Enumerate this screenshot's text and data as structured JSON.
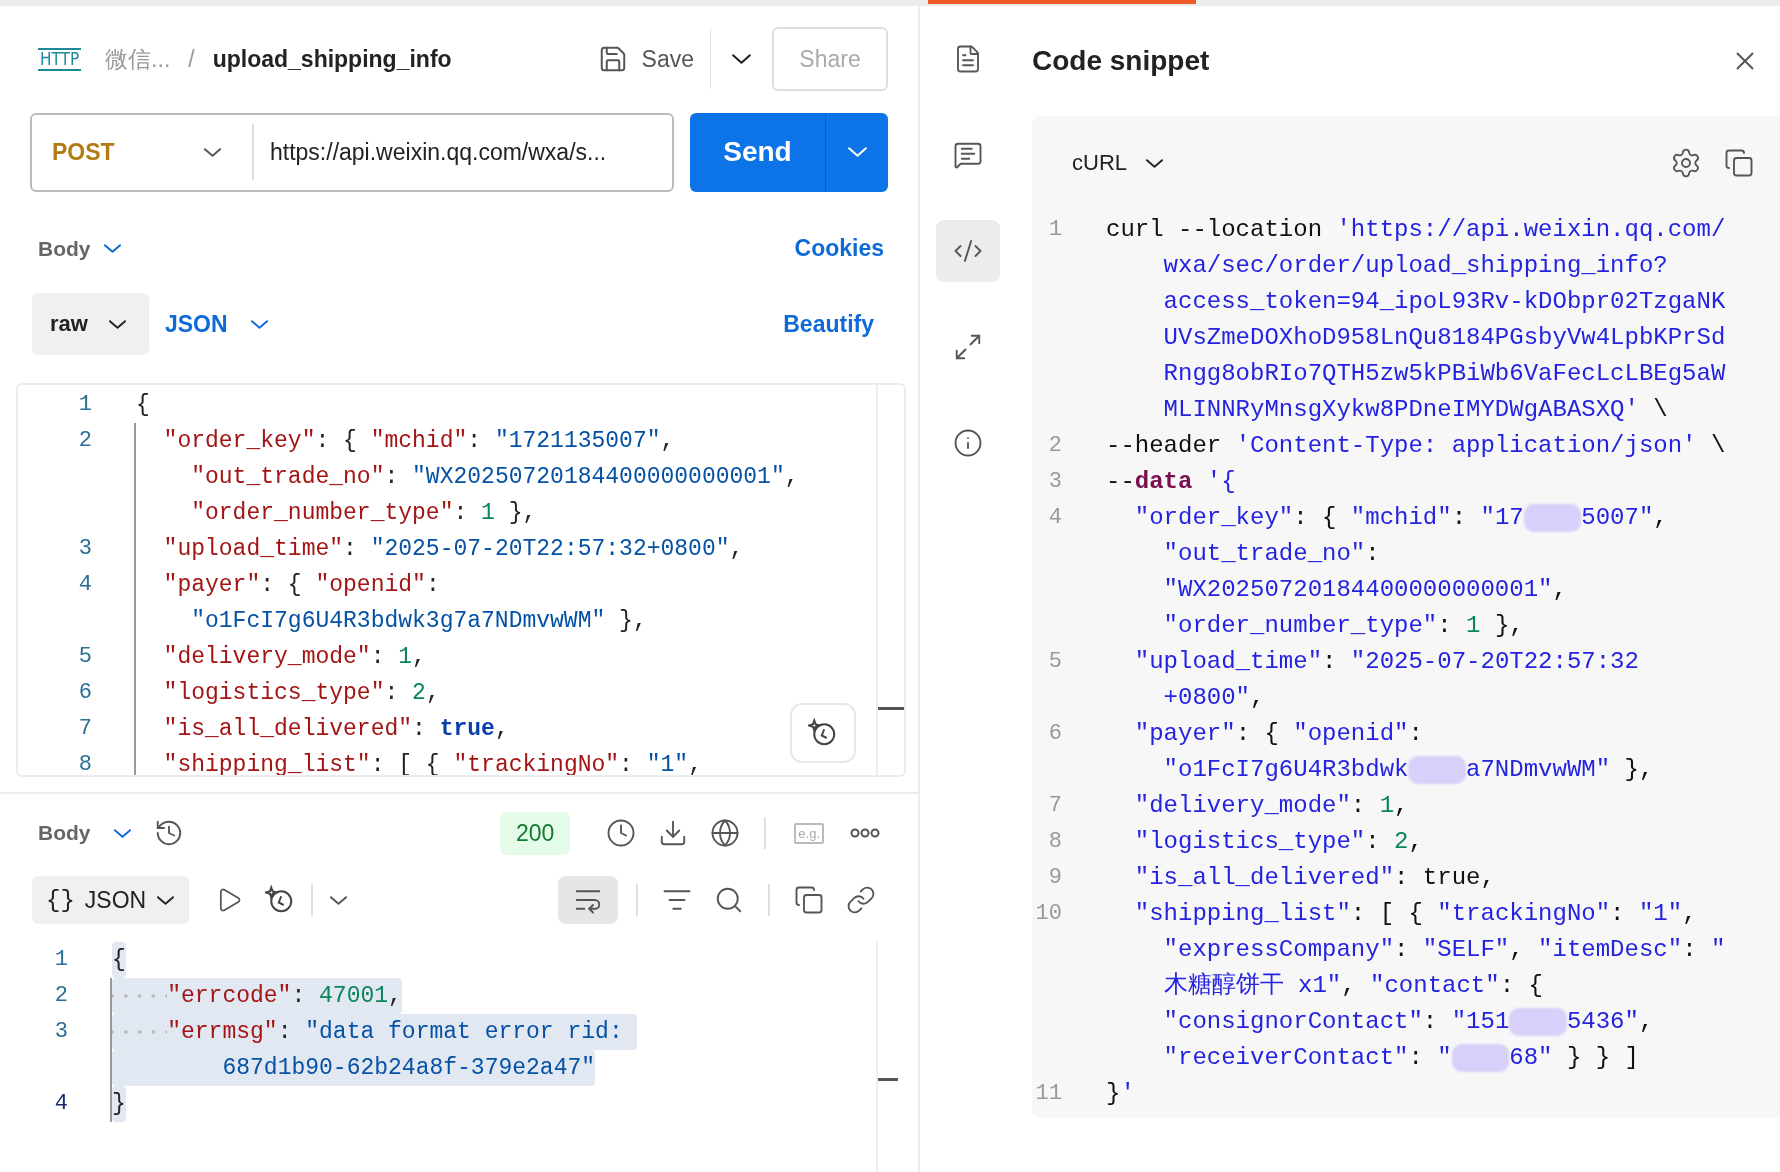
{
  "header": {
    "badge": "HTTP",
    "parent": "微信...",
    "separator": "/",
    "title": "upload_shipping_info",
    "save": "Save",
    "share": "Share"
  },
  "request": {
    "method": "POST",
    "url": "https://api.weixin.qq.com/wxa/s...",
    "send": "Send"
  },
  "body_bar": {
    "label": "Body",
    "link": "Cookies"
  },
  "format_bar": {
    "mode": "raw",
    "language": "JSON",
    "action": "Beautify"
  },
  "request_code": [
    {
      "number": "1",
      "wraps": [
        {
          "spans": [
            {
              "kind": "punct",
              "text": "{"
            }
          ]
        }
      ]
    },
    {
      "number": "2",
      "wraps": [
        {
          "spans": [
            {
              "kind": "key",
              "text": "  \"order_key\""
            },
            {
              "kind": "punct",
              "text": ": { "
            },
            {
              "kind": "key",
              "text": "\"mchid\""
            },
            {
              "kind": "punct",
              "text": ": "
            },
            {
              "kind": "string",
              "text": "\"1721135007\""
            },
            {
              "kind": "punct",
              "text": ","
            }
          ]
        },
        {
          "spans": [
            {
              "kind": "key",
              "text": "    \"out_trade_no\""
            },
            {
              "kind": "punct",
              "text": ": "
            },
            {
              "kind": "string",
              "text": "\"WX20250720184400000000001\""
            },
            {
              "kind": "punct",
              "text": ","
            }
          ]
        },
        {
          "spans": [
            {
              "kind": "key",
              "text": "    \"order_number_type\""
            },
            {
              "kind": "punct",
              "text": ": "
            },
            {
              "kind": "number",
              "text": "1"
            },
            {
              "kind": "punct",
              "text": " },"
            }
          ]
        }
      ]
    },
    {
      "number": "3",
      "wraps": [
        {
          "spans": [
            {
              "kind": "key",
              "text": "  \"upload_time\""
            },
            {
              "kind": "punct",
              "text": ": "
            },
            {
              "kind": "string",
              "text": "\"2025-07-20T22:57:32+0800\""
            },
            {
              "kind": "punct",
              "text": ","
            }
          ]
        }
      ]
    },
    {
      "number": "4",
      "wraps": [
        {
          "spans": [
            {
              "kind": "key",
              "text": "  \"payer\""
            },
            {
              "kind": "punct",
              "text": ": { "
            },
            {
              "kind": "key",
              "text": "\"openid\""
            },
            {
              "kind": "punct",
              "text": ":"
            }
          ]
        },
        {
          "spans": [
            {
              "kind": "string",
              "text": "    \"o1FcI7g6U4R3bdwk3g7a7NDmvwWM\""
            },
            {
              "kind": "punct",
              "text": " },"
            }
          ]
        }
      ]
    },
    {
      "number": "5",
      "wraps": [
        {
          "spans": [
            {
              "kind": "key",
              "text": "  \"delivery_mode\""
            },
            {
              "kind": "punct",
              "text": ": "
            },
            {
              "kind": "number",
              "text": "1"
            },
            {
              "kind": "punct",
              "text": ","
            }
          ]
        }
      ]
    },
    {
      "number": "6",
      "wraps": [
        {
          "spans": [
            {
              "kind": "key",
              "text": "  \"logistics_type\""
            },
            {
              "kind": "punct",
              "text": ": "
            },
            {
              "kind": "number",
              "text": "2"
            },
            {
              "kind": "punct",
              "text": ","
            }
          ]
        }
      ]
    },
    {
      "number": "7",
      "wraps": [
        {
          "spans": [
            {
              "kind": "key",
              "text": "  \"is_all_delivered\""
            },
            {
              "kind": "punct",
              "text": ": "
            },
            {
              "kind": "bool",
              "text": "true"
            },
            {
              "kind": "punct",
              "text": ","
            }
          ]
        }
      ]
    },
    {
      "number": "8",
      "wraps": [
        {
          "spans": [
            {
              "kind": "key",
              "text": "  \"shipping_list\""
            },
            {
              "kind": "punct",
              "text": ": [ { "
            },
            {
              "kind": "key",
              "text": "\"trackingNo\""
            },
            {
              "kind": "punct",
              "text": ": "
            },
            {
              "kind": "string",
              "text": "\"1\""
            },
            {
              "kind": "punct",
              "text": ","
            }
          ]
        }
      ]
    }
  ],
  "response": {
    "label": "Body",
    "status": "200",
    "eg": "e.g.",
    "format_icon": "{}",
    "format": "JSON",
    "wrap_selected": true,
    "selected": true,
    "code": [
      {
        "number": "1",
        "current": false,
        "wraps": [
          {
            "dots": false,
            "spans": [
              {
                "kind": "punct",
                "text": "{"
              }
            ]
          }
        ]
      },
      {
        "number": "2",
        "current": false,
        "wraps": [
          {
            "dots": true,
            "spans": [
              {
                "kind": "key",
                "text": "\"errcode\""
              },
              {
                "kind": "punct",
                "text": ": "
              },
              {
                "kind": "number",
                "text": "47001"
              },
              {
                "kind": "punct",
                "text": ","
              }
            ]
          }
        ]
      },
      {
        "number": "3",
        "current": false,
        "wraps": [
          {
            "dots": true,
            "spans": [
              {
                "kind": "key",
                "text": "\"errmsg\""
              },
              {
                "kind": "punct",
                "text": ": "
              },
              {
                "kind": "string",
                "text": "\"data format error rid: "
              }
            ]
          },
          {
            "dots": false,
            "spans": [
              {
                "kind": "string",
                "text": "        687d1b90-62b24a8f-379e2a47\""
              }
            ]
          }
        ]
      },
      {
        "number": "4",
        "current": true,
        "wraps": [
          {
            "dots": false,
            "spans": [
              {
                "kind": "punct",
                "text": "}"
              }
            ]
          }
        ]
      }
    ]
  },
  "side_tools": [
    {
      "selected": false
    },
    {
      "selected": false
    },
    {
      "selected": true
    },
    {
      "selected": false
    },
    {
      "selected": false
    }
  ],
  "snippet": {
    "title": "Code snippet",
    "language": "cURL",
    "code": [
      {
        "number": "1",
        "wraps": [
          {
            "spans": [
              {
                "kind": "punct",
                "text": "curl --location "
              },
              {
                "kind": "url",
                "text": "'https://api.weixin.qq.com/"
              }
            ]
          },
          {
            "spans": [
              {
                "kind": "url",
                "text": "    wxa/sec/order/upload_shipping_info?"
              }
            ]
          },
          {
            "spans": [
              {
                "kind": "url",
                "text": "    access_token=94_ipoL93Rv-kDObpr02TzgaNK"
              }
            ]
          },
          {
            "spans": [
              {
                "kind": "url",
                "text": "    UVsZmeDOXhoD958LnQu8184PGsbyVw4LpbKPrSd"
              }
            ]
          },
          {
            "spans": [
              {
                "kind": "url",
                "text": "    Rngg8obRIo7QTH5zw5kPBiWb6VaFecLcLBEg5aW"
              }
            ]
          },
          {
            "spans": [
              {
                "kind": "url",
                "text": "    MLINNRyMnsgXykw8PDneIMYDWgABASXQ'"
              },
              {
                "kind": "punct",
                "text": " \\"
              }
            ]
          }
        ]
      },
      {
        "number": "2",
        "wraps": [
          {
            "spans": [
              {
                "kind": "punct",
                "text": "--header "
              },
              {
                "kind": "url",
                "text": "'Content-Type: application/json'"
              },
              {
                "kind": "punct",
                "text": " \\"
              }
            ]
          }
        ]
      },
      {
        "number": "3",
        "wraps": [
          {
            "spans": [
              {
                "kind": "punct",
                "text": "--"
              },
              {
                "kind": "keyword",
                "text": "data"
              },
              {
                "kind": "url",
                "text": " '{"
              }
            ]
          }
        ]
      },
      {
        "number": "4",
        "wraps": [
          {
            "spans": [
              {
                "kind": "key",
                "text": "  \"order_key\""
              },
              {
                "kind": "punct",
                "text": ": { "
              },
              {
                "kind": "key",
                "text": "\"mchid\""
              },
              {
                "kind": "punct",
                "text": ": "
              },
              {
                "kind": "string",
                "text": "\"17"
              },
              {
                "kind": "blur"
              },
              {
                "kind": "string",
                "text": "5007\""
              },
              {
                "kind": "punct",
                "text": ","
              }
            ]
          },
          {
            "spans": [
              {
                "kind": "key",
                "text": "    \"out_trade_no\""
              },
              {
                "kind": "punct",
                "text": ":"
              }
            ]
          },
          {
            "spans": [
              {
                "kind": "string",
                "text": "    \"WX20250720184400000000001\""
              },
              {
                "kind": "punct",
                "text": ","
              }
            ]
          },
          {
            "spans": [
              {
                "kind": "key",
                "text": "    \"order_number_type\""
              },
              {
                "kind": "punct",
                "text": ": "
              },
              {
                "kind": "number",
                "text": "1"
              },
              {
                "kind": "punct",
                "text": " },"
              }
            ]
          }
        ]
      },
      {
        "number": "5",
        "wraps": [
          {
            "spans": [
              {
                "kind": "key",
                "text": "  \"upload_time\""
              },
              {
                "kind": "punct",
                "text": ": "
              },
              {
                "kind": "string",
                "text": "\"2025-07-20T22:57:32"
              }
            ]
          },
          {
            "spans": [
              {
                "kind": "string",
                "text": "    +0800\""
              },
              {
                "kind": "punct",
                "text": ","
              }
            ]
          }
        ]
      },
      {
        "number": "6",
        "wraps": [
          {
            "spans": [
              {
                "kind": "key",
                "text": "  \"payer\""
              },
              {
                "kind": "punct",
                "text": ": { "
              },
              {
                "kind": "key",
                "text": "\"openid\""
              },
              {
                "kind": "punct",
                "text": ":"
              }
            ]
          },
          {
            "spans": [
              {
                "kind": "string",
                "text": "    \"o1FcI7g6U4R3bdwk"
              },
              {
                "kind": "blur"
              },
              {
                "kind": "string",
                "text": "a7NDmvwWM\""
              },
              {
                "kind": "punct",
                "text": " },"
              }
            ]
          }
        ]
      },
      {
        "number": "7",
        "wraps": [
          {
            "spans": [
              {
                "kind": "key",
                "text": "  \"delivery_mode\""
              },
              {
                "kind": "punct",
                "text": ": "
              },
              {
                "kind": "number",
                "text": "1"
              },
              {
                "kind": "punct",
                "text": ","
              }
            ]
          }
        ]
      },
      {
        "number": "8",
        "wraps": [
          {
            "spans": [
              {
                "kind": "key",
                "text": "  \"logistics_type\""
              },
              {
                "kind": "punct",
                "text": ": "
              },
              {
                "kind": "number",
                "text": "2"
              },
              {
                "kind": "punct",
                "text": ","
              }
            ]
          }
        ]
      },
      {
        "number": "9",
        "wraps": [
          {
            "spans": [
              {
                "kind": "key",
                "text": "  \"is_all_delivered\""
              },
              {
                "kind": "punct",
                "text": ": "
              },
              {
                "kind": "bool",
                "text": "true"
              },
              {
                "kind": "punct",
                "text": ","
              }
            ]
          }
        ]
      },
      {
        "number": "10",
        "wraps": [
          {
            "spans": [
              {
                "kind": "key",
                "text": "  \"shipping_list\""
              },
              {
                "kind": "punct",
                "text": ": [ { "
              },
              {
                "kind": "key",
                "text": "\"trackingNo\""
              },
              {
                "kind": "punct",
                "text": ": "
              },
              {
                "kind": "string",
                "text": "\"1\""
              },
              {
                "kind": "punct",
                "text": ","
              }
            ]
          },
          {
            "spans": [
              {
                "kind": "key",
                "text": "    \"expressCompany\""
              },
              {
                "kind": "punct",
                "text": ": "
              },
              {
                "kind": "string",
                "text": "\"SELF\""
              },
              {
                "kind": "punct",
                "text": ", "
              },
              {
                "kind": "key",
                "text": "\"itemDesc\""
              },
              {
                "kind": "punct",
                "text": ": "
              },
              {
                "kind": "string",
                "text": "\""
              }
            ]
          },
          {
            "spans": [
              {
                "kind": "string",
                "text": "    木糖醇饼干 x1\""
              },
              {
                "kind": "punct",
                "text": ", "
              },
              {
                "kind": "key",
                "text": "\"contact\""
              },
              {
                "kind": "punct",
                "text": ": {"
              }
            ]
          },
          {
            "spans": [
              {
                "kind": "key",
                "text": "    \"consignorContact\""
              },
              {
                "kind": "punct",
                "text": ": "
              },
              {
                "kind": "string",
                "text": "\"151"
              },
              {
                "kind": "blur"
              },
              {
                "kind": "string",
                "text": "5436\""
              },
              {
                "kind": "punct",
                "text": ","
              }
            ]
          },
          {
            "spans": [
              {
                "kind": "key",
                "text": "    \"receiverContact\""
              },
              {
                "kind": "punct",
                "text": ": "
              },
              {
                "kind": "string",
                "text": "\""
              },
              {
                "kind": "blur"
              },
              {
                "kind": "string",
                "text": "68\""
              },
              {
                "kind": "punct",
                "text": " } } ]"
              }
            ]
          }
        ]
      },
      {
        "number": "11",
        "wraps": [
          {
            "spans": [
              {
                "kind": "punct",
                "text": "}"
              },
              {
                "kind": "url",
                "text": "'"
              }
            ]
          }
        ]
      }
    ]
  }
}
